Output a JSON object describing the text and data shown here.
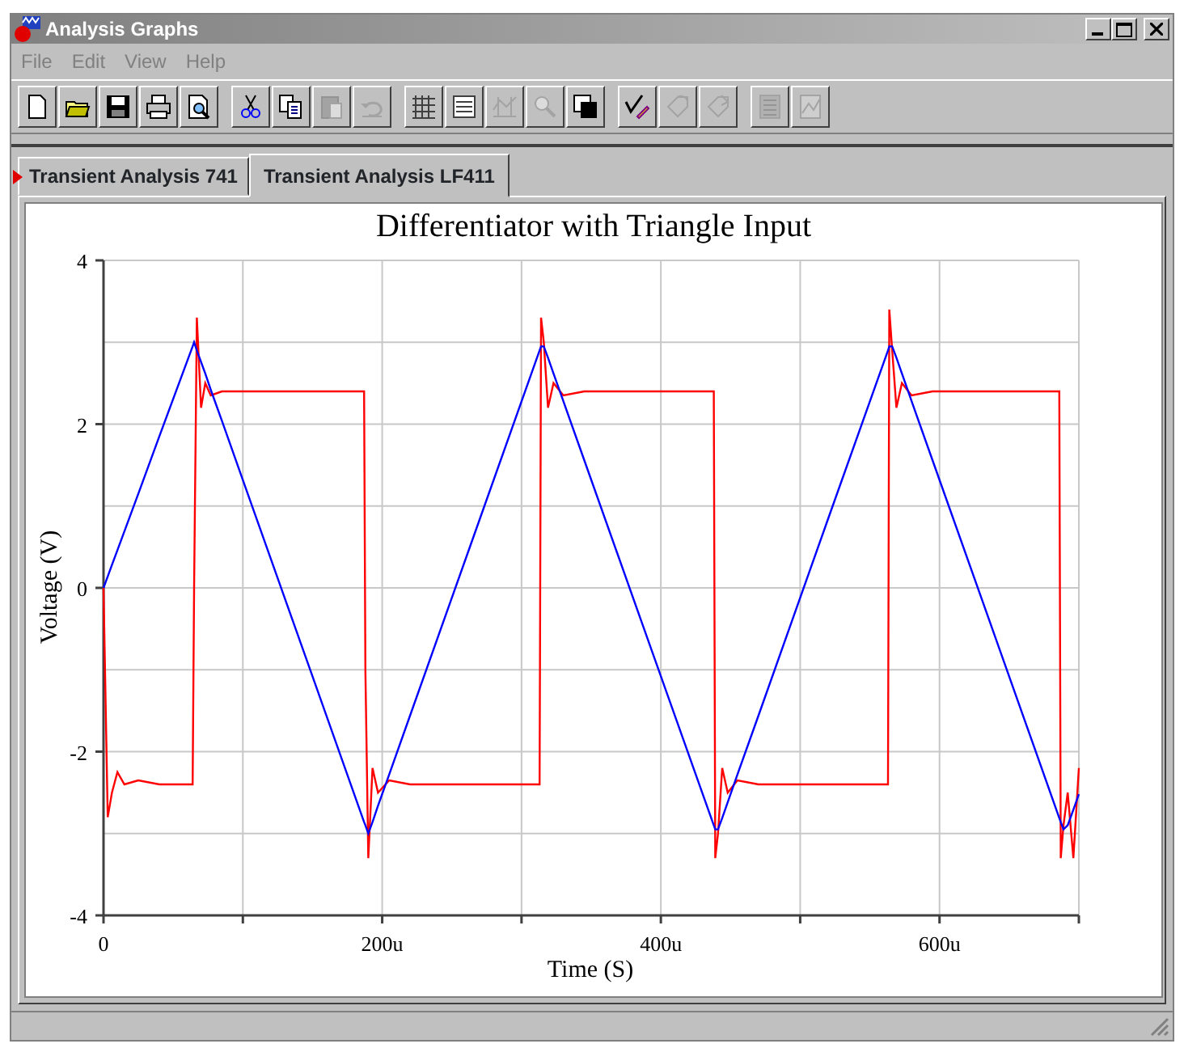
{
  "window": {
    "title": "Analysis Graphs"
  },
  "menu": [
    {
      "label": "File",
      "disabled": true
    },
    {
      "label": "Edit",
      "disabled": true
    },
    {
      "label": "View",
      "disabled": true
    },
    {
      "label": "Help",
      "disabled": true
    }
  ],
  "toolbar": [
    [
      {
        "disabled": false
      },
      {
        "disabled": false
      },
      {
        "disabled": false
      },
      {
        "disabled": false
      },
      {
        "disabled": false
      }
    ],
    [
      {
        "disabled": false
      },
      {
        "disabled": false
      },
      {
        "disabled": true
      },
      {
        "disabled": true
      }
    ],
    [
      {
        "disabled": false
      },
      {
        "disabled": false
      },
      {
        "disabled": true
      },
      {
        "disabled": true
      },
      {
        "disabled": false
      }
    ],
    [
      {
        "disabled": false
      },
      {
        "disabled": true
      },
      {
        "disabled": true
      }
    ],
    [
      {
        "disabled": true
      },
      {
        "disabled": true
      }
    ]
  ],
  "tabs": [
    {
      "label": "Transient Analysis 741",
      "selected": false,
      "flagged": true
    },
    {
      "label": "Transient Analysis LF411",
      "selected": true,
      "flagged": false
    }
  ],
  "graph": {
    "chart_data": {
      "type": "line",
      "title": "Differentiator with Triangle Input",
      "xlabel": "Time (S)",
      "ylabel": "Voltage (V)",
      "x": [
        0,
        3,
        6,
        10,
        15,
        25,
        40,
        64,
        65,
        67,
        70,
        73,
        77,
        85,
        100,
        150,
        187,
        188,
        190,
        193,
        197,
        205,
        220,
        270,
        313,
        314,
        316,
        319,
        323,
        330,
        345,
        400,
        438,
        439,
        441,
        444,
        448,
        455,
        470,
        520,
        563,
        564,
        566,
        569,
        573,
        580,
        595,
        640,
        686,
        687,
        689,
        692,
        696,
        700
      ],
      "series": [
        {
          "color": "#ff0000",
          "values": [
            0,
            -2.8,
            -2.5,
            -2.25,
            -2.4,
            -2.35,
            -2.4,
            -2.4,
            0,
            3.3,
            2.2,
            2.5,
            2.35,
            2.4,
            2.4,
            2.4,
            2.4,
            -1,
            -3.3,
            -2.2,
            -2.5,
            -2.35,
            -2.4,
            -2.4,
            -2.4,
            3.3,
            3.0,
            2.2,
            2.5,
            2.35,
            2.4,
            2.4,
            2.4,
            -3.3,
            -3,
            -2.2,
            -2.5,
            -2.35,
            -2.4,
            -2.4,
            -2.4,
            3.4,
            2.9,
            2.2,
            2.5,
            2.35,
            2.4,
            2.4,
            2.4,
            -3.3,
            -2.9,
            -2.5,
            -3.3,
            -2.2
          ]
        },
        {
          "color": "#0000ff",
          "values": [
            0,
            0.14,
            0.28,
            0.46,
            0.69,
            1.15,
            1.85,
            2.95,
            3,
            2.9,
            2.76,
            2.62,
            2.42,
            2.04,
            1.32,
            -1.08,
            -2.86,
            -2.9,
            -3,
            -2.86,
            -2.66,
            -2.28,
            -1.56,
            0.84,
            2.9,
            2.95,
            2.95,
            2.81,
            2.62,
            2.28,
            1.56,
            -1.08,
            -2.9,
            -2.95,
            -2.95,
            -2.81,
            -2.62,
            -2.28,
            -1.56,
            0.84,
            2.9,
            2.95,
            2.95,
            2.81,
            2.62,
            2.28,
            1.56,
            -0.6,
            -2.81,
            -2.86,
            -2.95,
            -2.9,
            -2.71,
            -2.52
          ]
        }
      ],
      "xlim": [
        0,
        700
      ],
      "ylim": [
        -4,
        4
      ],
      "xticks": [
        {
          "value": 0,
          "label": "0"
        },
        {
          "value": 200,
          "label": "200u"
        },
        {
          "value": 400,
          "label": "400u"
        },
        {
          "value": 600,
          "label": "600u"
        }
      ],
      "yticks": [
        -4,
        -2,
        0,
        2,
        4
      ],
      "grid": true
    }
  }
}
